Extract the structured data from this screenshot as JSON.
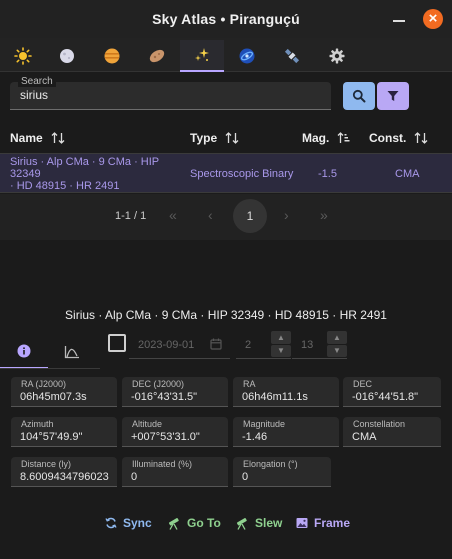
{
  "window": {
    "title": "Sky Atlas • Piranguçú",
    "close_glyph": "×"
  },
  "tabs": [
    {
      "icon": "sun-icon"
    },
    {
      "icon": "moon-icon"
    },
    {
      "icon": "planet-icon"
    },
    {
      "icon": "asteroid-icon"
    },
    {
      "icon": "stars-icon",
      "active": true
    },
    {
      "icon": "galaxy-icon"
    },
    {
      "icon": "satellite-icon"
    },
    {
      "icon": "gear-icon"
    }
  ],
  "search": {
    "label": "Search",
    "value": "sirius"
  },
  "table": {
    "columns": [
      "Name",
      "Type",
      "Mag.",
      "Const."
    ],
    "rows": [
      {
        "name_line1": "Sirius · Alp CMa · 9 CMa · HIP 32349",
        "name_line2": "· HD 48915 · HR 2491",
        "type": "Spectroscopic Binary",
        "mag": "-1.5",
        "const": "CMA"
      }
    ]
  },
  "pagination": {
    "range": "1-1 / 1",
    "current": "1",
    "first": "«",
    "prev": "‹",
    "next": "›",
    "last": "»"
  },
  "details": {
    "title": "Sirius · Alp CMa · 9 CMa · HIP 32349 · HD 48915 · HR 2491",
    "date_placeholder": "2023-09-01",
    "hour": "2",
    "minute": "13",
    "fields": [
      {
        "label": "RA (J2000)",
        "value": "06h45m07.3s"
      },
      {
        "label": "DEC (J2000)",
        "value": "-016°43'31.5\""
      },
      {
        "label": "RA",
        "value": "06h46m11.1s"
      },
      {
        "label": "DEC",
        "value": "-016°44'51.8\""
      },
      {
        "label": "Azimuth",
        "value": "104°57'49.9\""
      },
      {
        "label": "Altitude",
        "value": "+007°53'31.0\""
      },
      {
        "label": "Magnitude",
        "value": "-1.46"
      },
      {
        "label": "Constellation",
        "value": "CMA"
      },
      {
        "label": "Distance (ly)",
        "value": "8.6009434796023"
      },
      {
        "label": "Illuminated (%)",
        "value": "0"
      },
      {
        "label": "Elongation (°)",
        "value": "0"
      }
    ]
  },
  "actions": {
    "sync": "Sync",
    "goto": "Go To",
    "slew": "Slew",
    "frame": "Frame"
  },
  "colors": {
    "accent": "#b8a6ff",
    "sync": "#8fb9ef",
    "goto": "#8fd18f",
    "slew": "#8fd18f",
    "frame": "#b9a8f5",
    "close": "#f26b21"
  }
}
